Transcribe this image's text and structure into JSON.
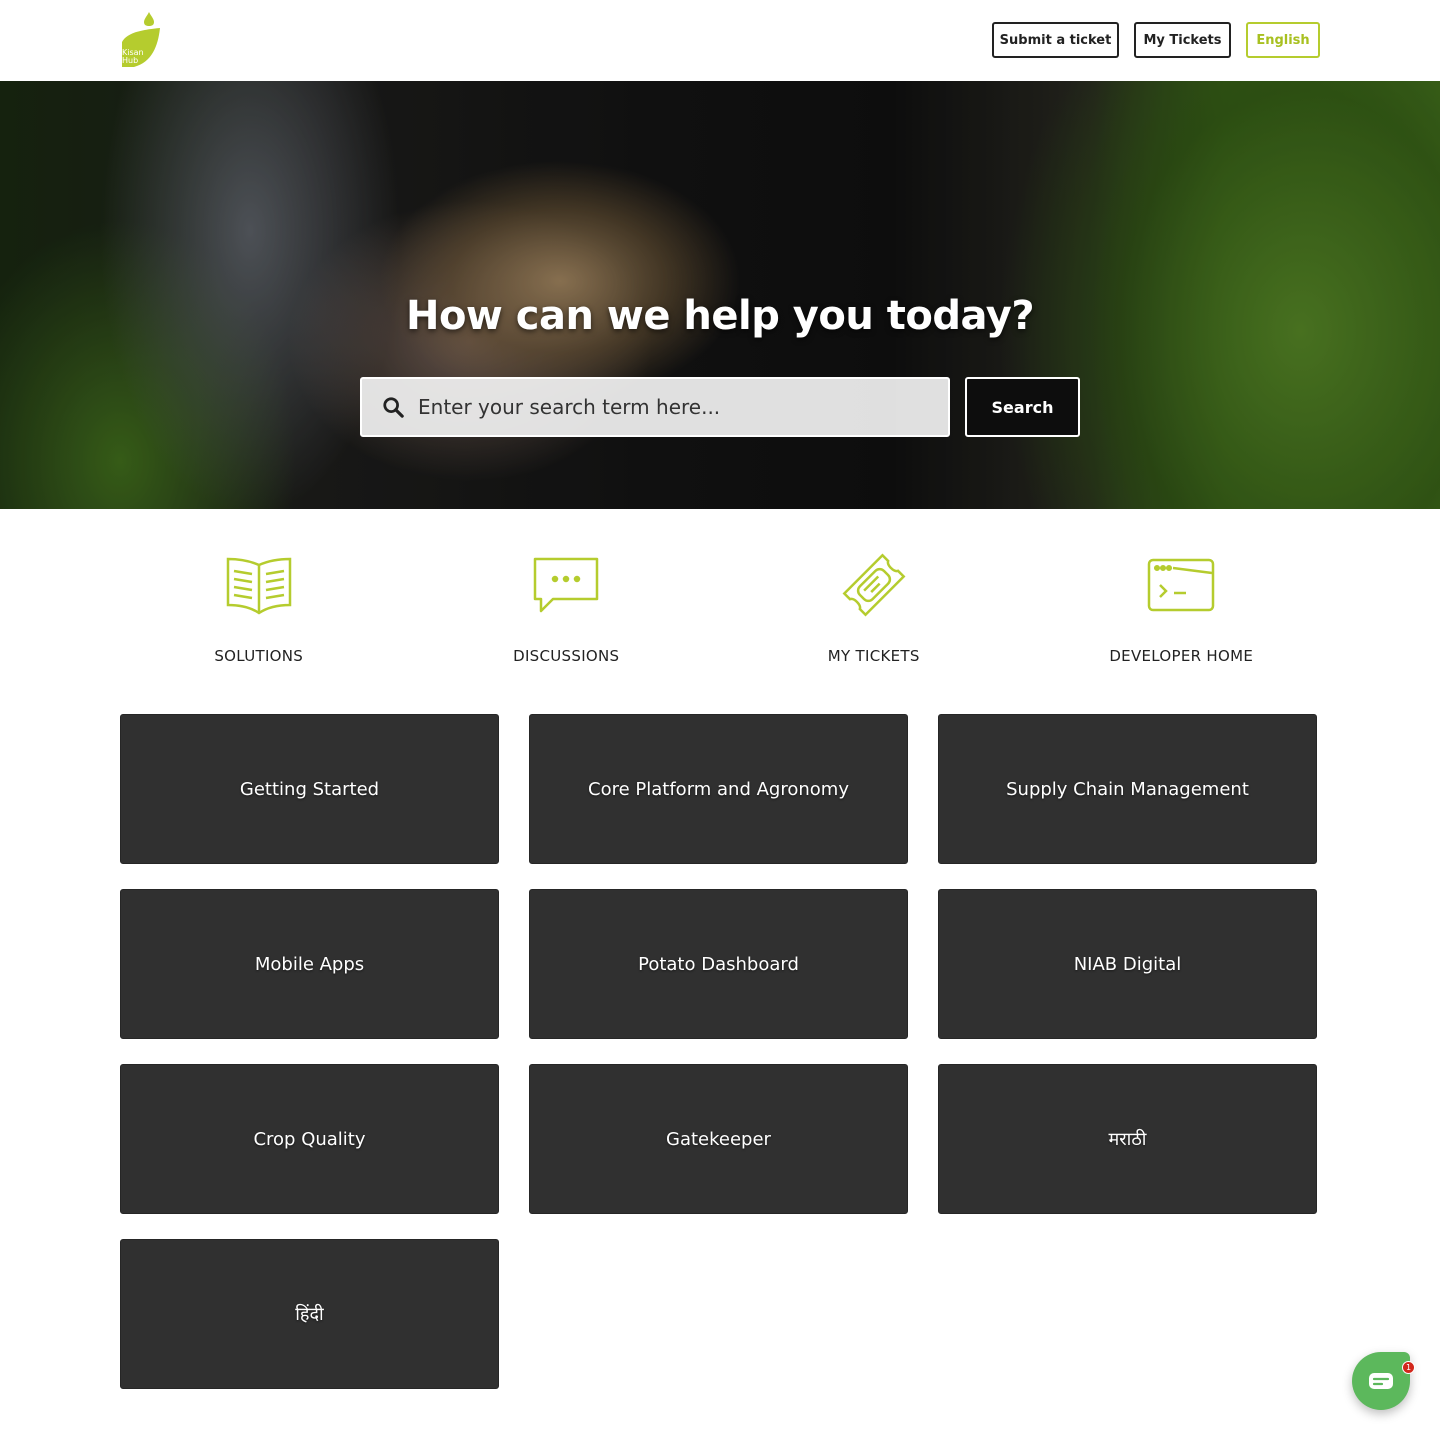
{
  "brand": {
    "name": "Kisan Hub",
    "logo_text_line1": "Kisan",
    "logo_text_line2": "Hub",
    "accent_color": "#b5cc2e"
  },
  "header": {
    "submit_ticket_label": "Submit a ticket",
    "my_tickets_label": "My Tickets",
    "language_label": "English"
  },
  "hero": {
    "title": "How can we help you today?",
    "search_placeholder": "Enter your search term here...",
    "search_value": "",
    "search_button_label": "Search"
  },
  "quick_links": [
    {
      "label": "SOLUTIONS",
      "icon": "book-icon"
    },
    {
      "label": "DISCUSSIONS",
      "icon": "chat-bubble-icon"
    },
    {
      "label": "MY TICKETS",
      "icon": "ticket-icon"
    },
    {
      "label": "DEVELOPER HOME",
      "icon": "terminal-icon"
    }
  ],
  "categories": [
    "Getting Started",
    "Core Platform and Agronomy",
    "Supply Chain Management",
    "Mobile Apps",
    "Potato Dashboard",
    "NIAB Digital",
    "Crop Quality",
    "Gatekeeper",
    "मराठी",
    "हिंदी"
  ],
  "chat_widget": {
    "unread_count": "1",
    "color": "#5cb85c"
  }
}
